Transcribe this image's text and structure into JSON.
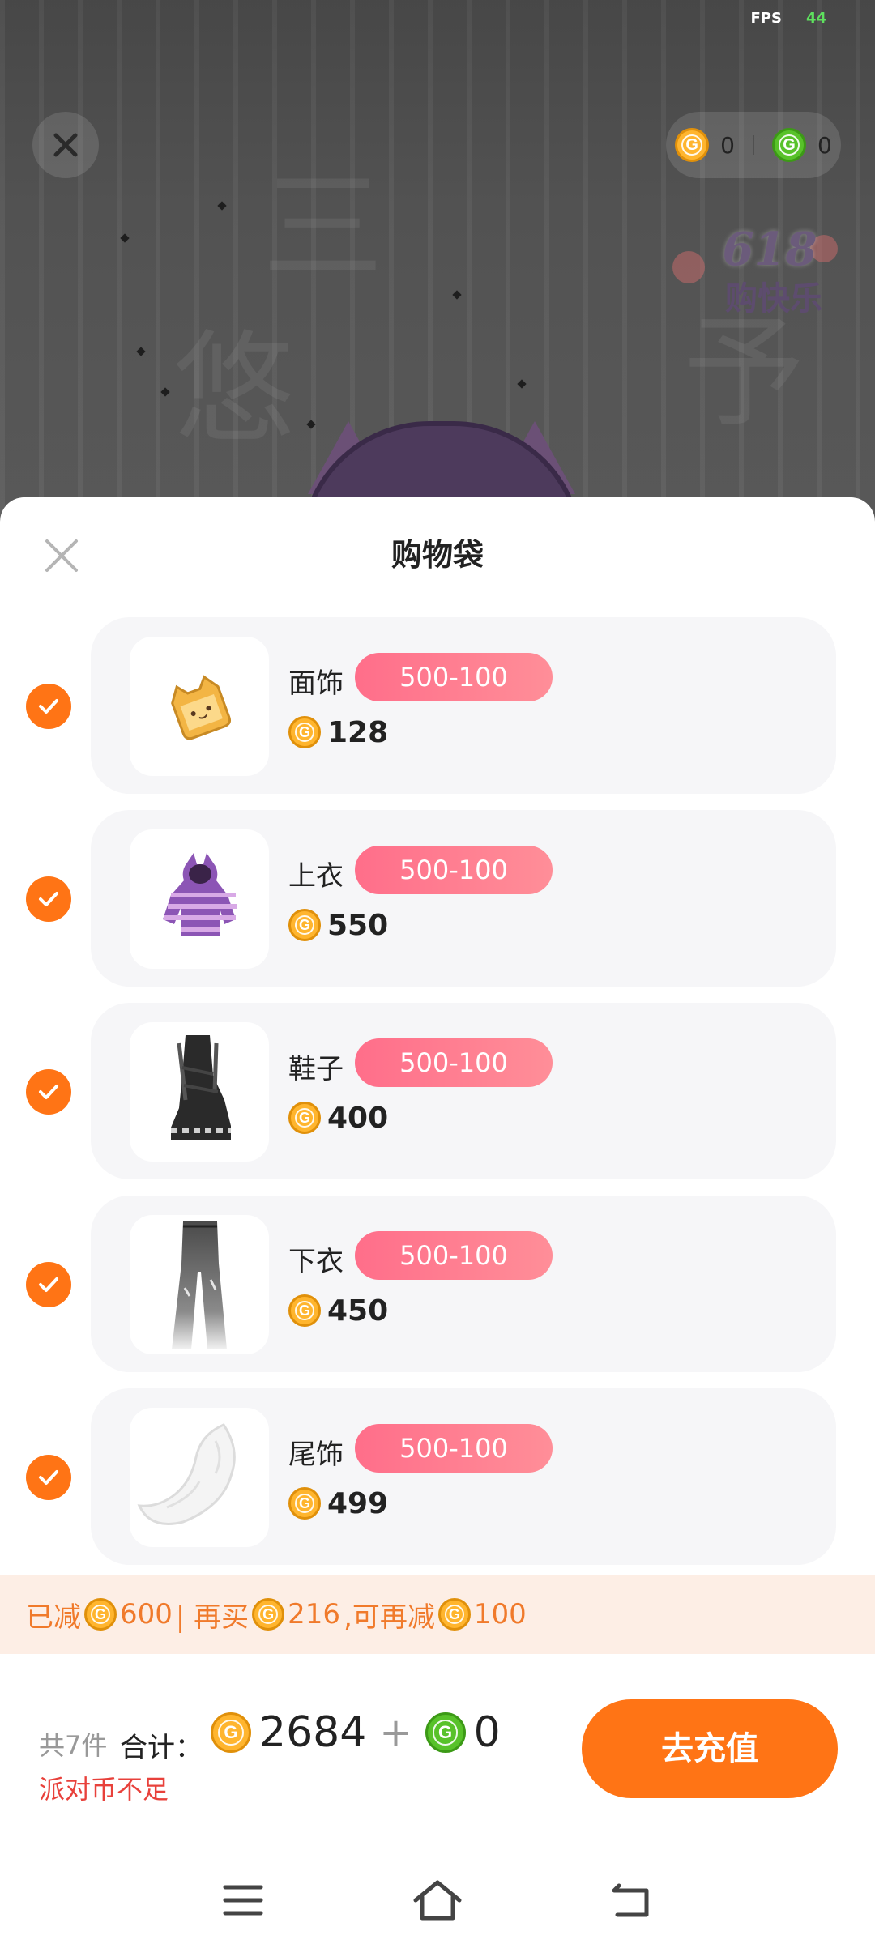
{
  "status": {
    "fps_label": "FPS",
    "fps_value": "44"
  },
  "top_bar": {
    "gold_balance": "0",
    "green_balance": "0"
  },
  "promo": {
    "line1": "618",
    "line2": "购快乐"
  },
  "sheet": {
    "title": "购物袋",
    "items": [
      {
        "name": "面饰",
        "tag": "500-100",
        "price": "128",
        "checked": true,
        "thumb": "face-accessory"
      },
      {
        "name": "上衣",
        "tag": "500-100",
        "price": "550",
        "checked": true,
        "thumb": "top"
      },
      {
        "name": "鞋子",
        "tag": "500-100",
        "price": "400",
        "checked": true,
        "thumb": "shoes"
      },
      {
        "name": "下衣",
        "tag": "500-100",
        "price": "450",
        "checked": true,
        "thumb": "bottoms"
      },
      {
        "name": "尾饰",
        "tag": "500-100",
        "price": "499",
        "checked": true,
        "thumb": "tail"
      }
    ],
    "discount_bar": {
      "reduced_label": "已减",
      "reduced_amount": "600",
      "buy_more_label": " | 再买",
      "buy_more_amount": "216",
      "reduce_more_label": ",可再减",
      "reduce_more_amount": "100"
    },
    "summary": {
      "count": "共7件",
      "total_label": "合计：",
      "gold_total": "2684",
      "plus": "+",
      "green_total": "0",
      "warning": "派对币不足"
    },
    "recharge_button": "去充值"
  },
  "colors": {
    "accent": "#ff7415",
    "tag_gradient_start": "#ff6e8a",
    "warning": "#e8413b",
    "discount_text": "#f07a2b",
    "gold_coin": "#ffb52e",
    "green_coin": "#58c22a"
  },
  "icons": [
    "close-icon",
    "gold-coin-icon",
    "green-coin-icon",
    "check-icon",
    "menu-icon",
    "home-icon",
    "back-icon"
  ]
}
